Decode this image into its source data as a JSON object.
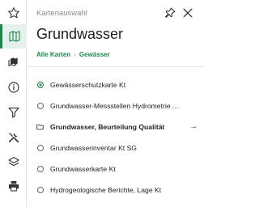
{
  "rail": {
    "items": [
      {
        "icon": "star-icon"
      },
      {
        "icon": "map-icon",
        "active": true
      },
      {
        "icon": "map-layers-icon"
      },
      {
        "icon": "info-icon"
      },
      {
        "icon": "filter-icon"
      },
      {
        "icon": "tools-icon"
      },
      {
        "icon": "layers-icon"
      },
      {
        "icon": "print-icon"
      }
    ]
  },
  "panel": {
    "label": "Kartenauswahl",
    "title": "Grundwasser",
    "breadcrumb": [
      "Alle Karten",
      "Gewässer"
    ],
    "items": [
      {
        "label": "Gewässerschutzkarte Kt",
        "type": "radio",
        "selected": true
      },
      {
        "label": "Grundwasser-Messstellen Hydrometrie ...",
        "type": "radio",
        "selected": false
      },
      {
        "label": "Grundwasser, Beurteilung Qualität",
        "type": "folder"
      },
      {
        "label": "Grundwasserinventar Kt SG",
        "type": "radio",
        "selected": false
      },
      {
        "label": "Grundwasserkarte Kt",
        "type": "radio",
        "selected": false
      },
      {
        "label": "Hydrogeologische Berichte, Lage Kt",
        "type": "radio",
        "selected": false
      }
    ]
  },
  "colors": {
    "accent": "#1a8a4a",
    "active_bg": "#e6f0ec"
  }
}
